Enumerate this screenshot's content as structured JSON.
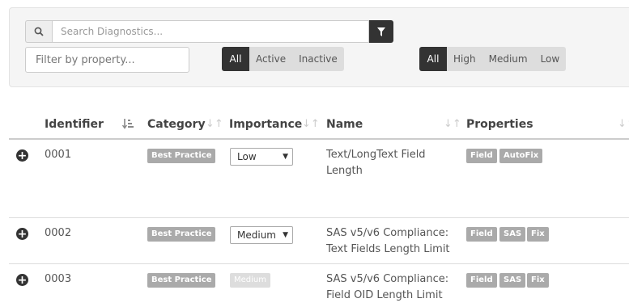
{
  "search": {
    "placeholder": "Search Diagnostics..."
  },
  "property_filter": {
    "placeholder": "Filter by property..."
  },
  "status_filter": [
    {
      "label": "All",
      "active": true
    },
    {
      "label": "Active",
      "active": false
    },
    {
      "label": "Inactive",
      "active": false
    }
  ],
  "importance_filter": [
    {
      "label": "All",
      "active": true
    },
    {
      "label": "High",
      "active": false
    },
    {
      "label": "Medium",
      "active": false
    },
    {
      "label": "Low",
      "active": false
    }
  ],
  "table": {
    "columns": [
      "Identifier",
      "Category",
      "Importance",
      "Name",
      "Properties"
    ],
    "rows": [
      {
        "id": "0001",
        "category": "Best Practice",
        "importance": "Low",
        "name": "Text/LongText Field Length",
        "properties": [
          "Field",
          "AutoFix"
        ]
      },
      {
        "id": "0002",
        "category": "Best Practice",
        "importance": "Medium",
        "name": "SAS v5/v6 Compliance: Text Fields Length Limit",
        "properties": [
          "Field",
          "SAS",
          "Fix"
        ]
      },
      {
        "id": "0003",
        "category": "Best Practice",
        "importance": "Medium",
        "name": "SAS v5/v6 Compliance: Field OID Length Limit",
        "properties": [
          "Field",
          "SAS",
          "Fix"
        ]
      }
    ]
  }
}
